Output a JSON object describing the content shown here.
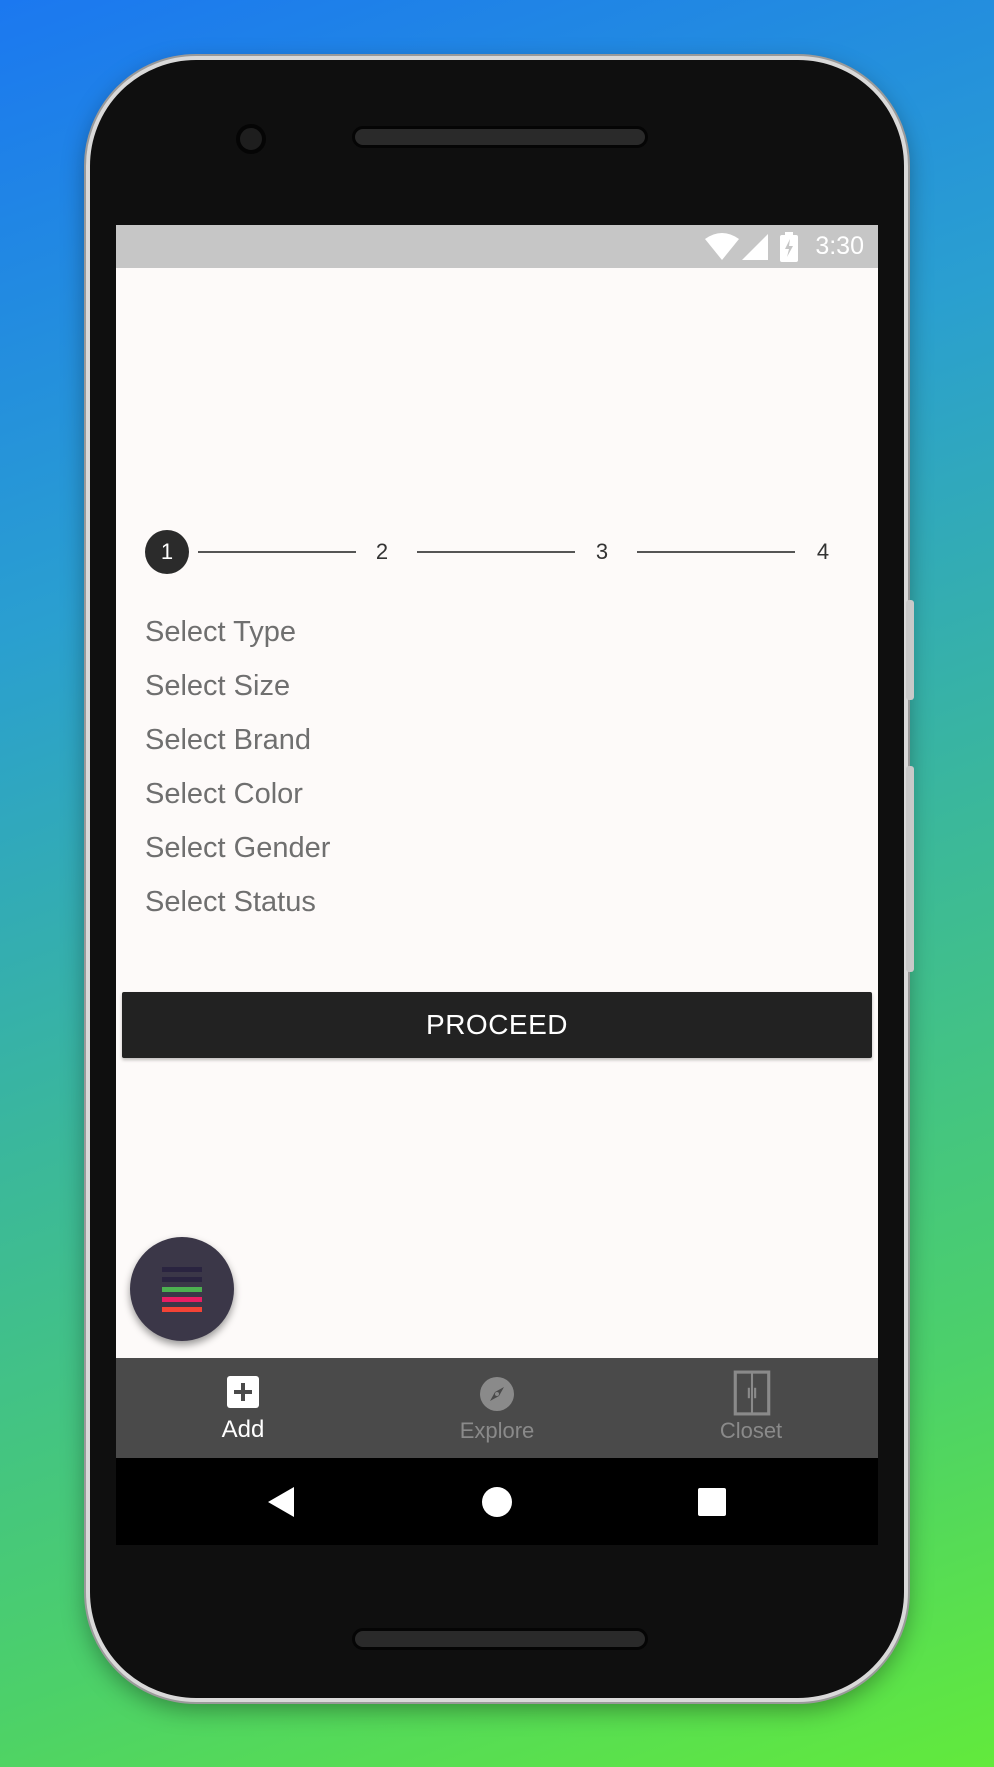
{
  "status_bar": {
    "time": "3:30"
  },
  "stepper": {
    "steps": [
      "1",
      "2",
      "3",
      "4"
    ],
    "current": 1
  },
  "options": [
    "Select Type",
    "Select Size",
    "Select Brand",
    "Select Color",
    "Select Gender",
    "Select Status"
  ],
  "proceed_label": "PROCEED",
  "fab": {
    "icon": "menu-lines-icon",
    "bar_colors": [
      "#2a2440",
      "#2a2440",
      "#4caf50",
      "#e91e63",
      "#f44336"
    ]
  },
  "bottom_nav": {
    "items": [
      {
        "label": "Add",
        "icon": "add-box-icon",
        "active": true
      },
      {
        "label": "Explore",
        "icon": "compass-icon",
        "active": false
      },
      {
        "label": "Closet",
        "icon": "closet-icon",
        "active": false
      }
    ]
  },
  "system_nav": [
    "back-icon",
    "home-icon",
    "recents-icon"
  ]
}
